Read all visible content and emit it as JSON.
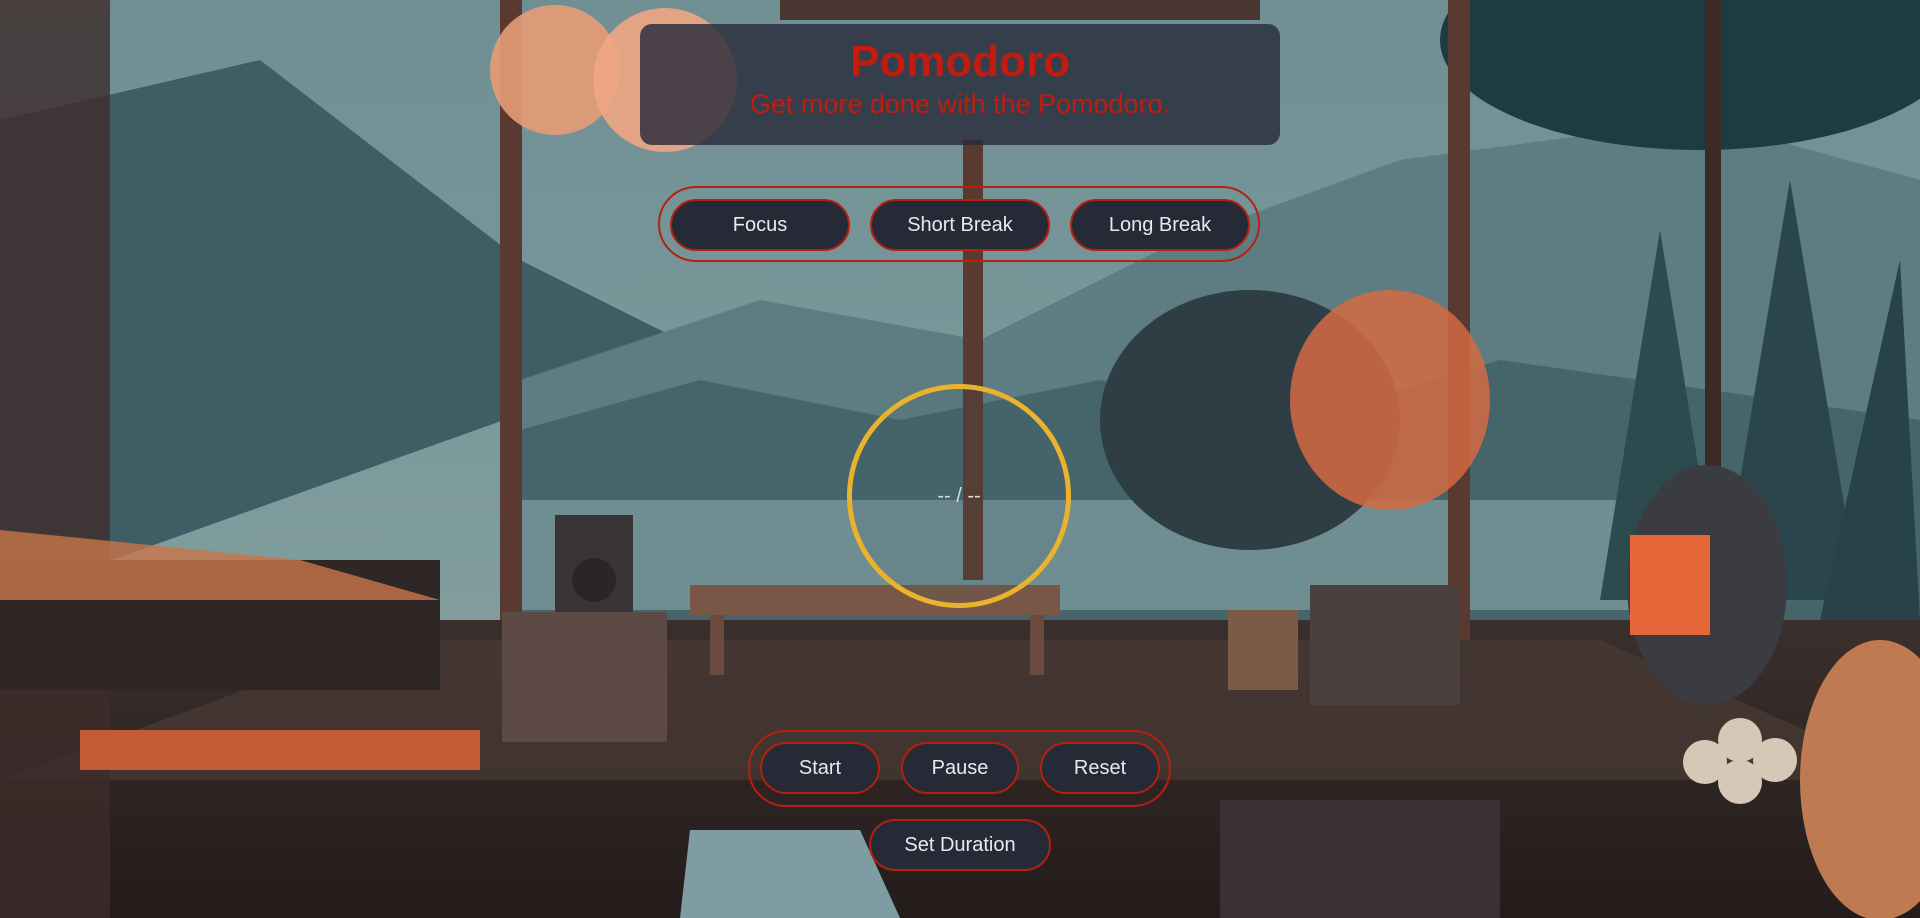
{
  "header": {
    "title": "Pomodoro",
    "subtitle": "Get more done with the Pomodoro."
  },
  "modes": [
    {
      "label": "Focus"
    },
    {
      "label": "Short Break"
    },
    {
      "label": "Long Break"
    }
  ],
  "timer": {
    "display": "-- / --"
  },
  "controls": {
    "start": "Start",
    "pause": "Pause",
    "reset": "Reset",
    "set_duration": "Set Duration"
  },
  "colors": {
    "accent_red": "#b5200f",
    "title_red": "#c21b10",
    "ring_gold": "#eab32e",
    "button_bg": "#262a36"
  },
  "icons": {
    "background": "lofi-cabin-illustration"
  }
}
